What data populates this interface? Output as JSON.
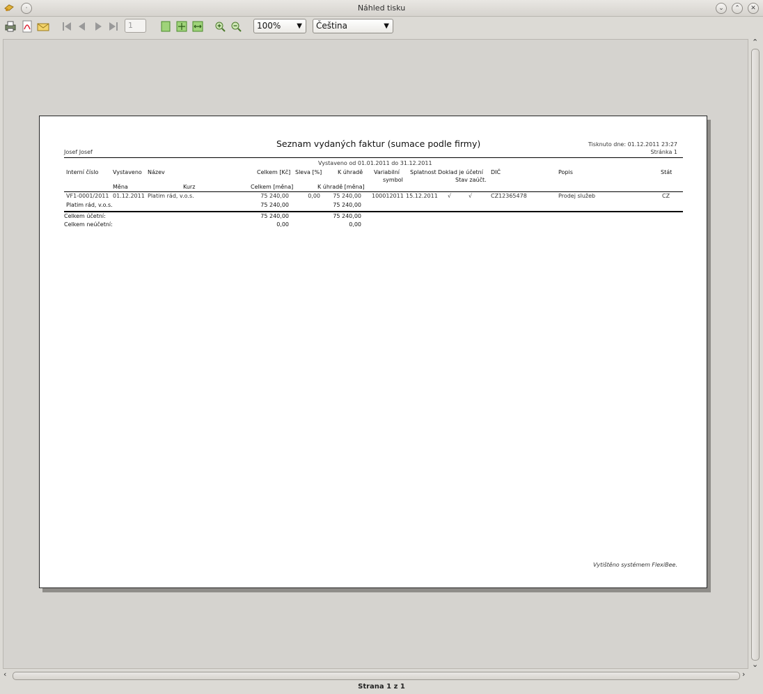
{
  "window": {
    "title": "Náhled tisku"
  },
  "toolbar": {
    "page_number": "1",
    "zoom": "100%",
    "language": "Čeština"
  },
  "report": {
    "title": "Seznam vydaných faktur (sumace podle firmy)",
    "printed": "Tisknuto dne: 01.12.2011 23:27",
    "user": "Josef Josef",
    "page": "Stránka 1",
    "period": "Vystaveno od 01.01.2011 do 31.12.2011",
    "headers": {
      "interni_cislo": "Interní číslo",
      "vystaveno": "Vystaveno",
      "nazev": "Název",
      "celkem_kc": "Celkem [Kč]",
      "sleva": "Sleva [%]",
      "k_uhrade": "K úhradě",
      "variabilni": "Variabilní",
      "symbol": "symbol",
      "splatnost": "Splatnost",
      "doklad_ucetni": "Doklad je účetní",
      "stav_zauct": "Stav zaúčt.",
      "dic": "DIČ",
      "popis": "Popis",
      "stat": "Stát",
      "mena": "Měna",
      "kurz": "Kurz",
      "celkem_mena": "Celkem [měna]",
      "k_uhrade_mena": "K úhradě [měna]"
    },
    "row": {
      "interni_cislo": "VF1-0001/2011",
      "vystaveno": "01.12.2011",
      "nazev": "Platim rád, v.o.s.",
      "celkem": "75 240,00",
      "sleva": "0,00",
      "k_uhrade": "75 240,00",
      "variabilni": "100012011",
      "splatnost": "15.12.2011",
      "doklad_check": "√",
      "stav_check": "√",
      "dic": "CZ12365478",
      "popis": "Prodej služeb",
      "stat": "CZ"
    },
    "group": {
      "name": "Platim rád, v.o.s.",
      "celkem": "75 240,00",
      "k_uhrade": "75 240,00"
    },
    "totals": {
      "ucetni_label": "Celkem účetní:",
      "ucetni_celkem": "75 240,00",
      "ucetni_k_uhrade": "75 240,00",
      "neucetni_label": "Celkem neúčetní:",
      "neucetni_celkem": "0,00",
      "neucetni_k_uhrade": "0,00"
    },
    "footer": "Vytištěno systémem FlexiBee."
  },
  "status": {
    "text": "Strana 1 z 1"
  }
}
